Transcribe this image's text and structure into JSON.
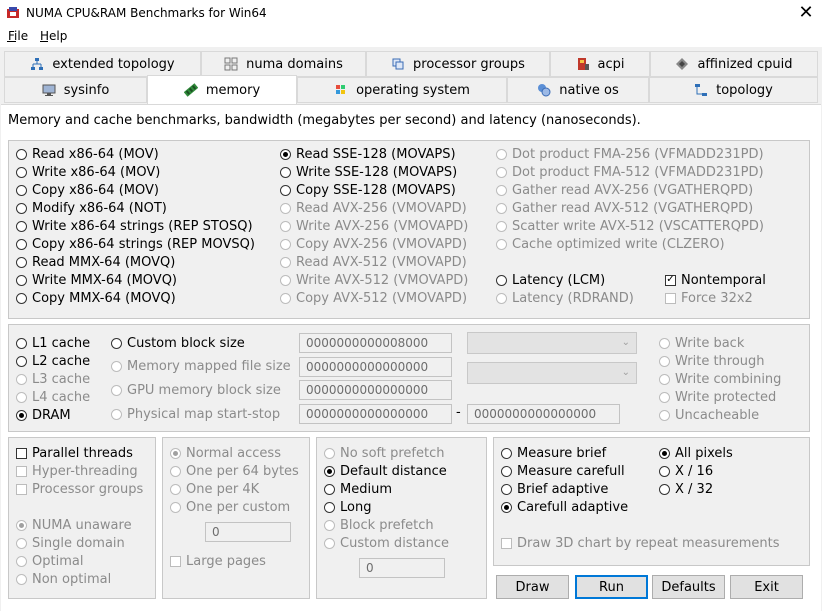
{
  "window": {
    "title": "NUMA CPU&RAM Benchmarks for Win64",
    "close": "✕"
  },
  "menu": {
    "file": "File",
    "help": "Help"
  },
  "tabs_row1": [
    {
      "label": "extended topology",
      "icon": "topology-tree-icon"
    },
    {
      "label": "numa domains",
      "icon": "numa-grid-icon"
    },
    {
      "label": "processor groups",
      "icon": "processor-groups-icon"
    },
    {
      "label": "acpi",
      "icon": "acpi-icon"
    },
    {
      "label": "affinized cpuid",
      "icon": "cpuid-chip-icon"
    }
  ],
  "tabs_row2": [
    {
      "label": "sysinfo",
      "icon": "monitor-icon"
    },
    {
      "label": "memory",
      "icon": "memory-module-icon",
      "active": true
    },
    {
      "label": "operating system",
      "icon": "windows-logo-icon"
    },
    {
      "label": "native os",
      "icon": "native-os-icon"
    },
    {
      "label": "topology",
      "icon": "topology-icon"
    }
  ],
  "description": "Memory and cache benchmarks, bandwidth (megabytes per second) and latency (nanoseconds).",
  "methods": {
    "col1": [
      "Read x86-64 (MOV)",
      "Write x86-64 (MOV)",
      "Copy x86-64 (MOV)",
      "Modify x86-64 (NOT)",
      "Write x86-64 strings (REP STOSQ)",
      "Copy x86-64 strings (REP MOVSQ)",
      "Read MMX-64 (MOVQ)",
      "Write MMX-64 (MOVQ)",
      "Copy MMX-64 (MOVQ)"
    ],
    "col2": [
      "Read SSE-128 (MOVAPS)",
      "Write SSE-128 (MOVAPS)",
      "Copy SSE-128 (MOVAPS)",
      "Read AVX-256 (VMOVAPD)",
      "Write AVX-256 (VMOVAPD)",
      "Copy AVX-256 (VMOVAPD)",
      "Read AVX-512 (VMOVAPD)",
      "Write AVX-512 (VMOVAPD)",
      "Copy AVX-512 (VMOVAPD)"
    ],
    "col3": [
      "Dot product FMA-256 (VFMADD231PD)",
      "Dot product FMA-512 (VFMADD231PD)",
      "Gather read AVX-256 (VGATHERQPD)",
      "Gather read AVX-512 (VGATHERQPD)",
      "Scatter write AVX-512 (VSCATTERQPD)",
      "Cache optimized write (CLZERO)",
      "Latency (LCM)",
      "Latency (RDRAND)"
    ],
    "nontemporal": "Nontemporal",
    "force32": "Force 32x2"
  },
  "target": {
    "levels": [
      "L1 cache",
      "L2 cache",
      "L3 cache",
      "L4 cache",
      "DRAM"
    ],
    "custom_block": "Custom block size",
    "mapped_file": "Memory mapped file size",
    "gpu_block": "GPU memory block size",
    "phys_map": "Physical map start-stop",
    "val_custom": "0000000000008000",
    "val_mapped": "0000000000000000",
    "val_gpu": "0000000000000000",
    "val_phys_start": "0000000000000000",
    "dash": "-",
    "val_phys_stop": "0000000000000000",
    "caching": [
      "Write back",
      "Write through",
      "Write combining",
      "Write protected",
      "Uncacheable"
    ]
  },
  "threads": {
    "parallel": "Parallel threads",
    "hyper": "Hyper-threading",
    "groups": "Processor groups",
    "numa": [
      "NUMA unaware",
      "Single domain",
      "Optimal",
      "Non optimal"
    ]
  },
  "access": {
    "options": [
      "Normal access",
      "One per 64 bytes",
      "One per 4K",
      "One per custom"
    ],
    "custom_val": "0",
    "large_pages": "Large pages"
  },
  "prefetch": {
    "options": [
      "No soft prefetch",
      "Default distance",
      "Medium",
      "Long",
      "Block prefetch",
      "Custom distance"
    ],
    "custom_val": "0"
  },
  "measure": {
    "options": [
      "Measure brief",
      "Measure carefull",
      "Brief adaptive",
      "Carefull adaptive"
    ],
    "pixels": [
      "All pixels",
      "X / 16",
      "X / 32"
    ],
    "draw3d": "Draw 3D chart by repeat measurements"
  },
  "buttons": {
    "draw": "Draw",
    "run": "Run",
    "defaults": "Defaults",
    "exit": "Exit"
  }
}
